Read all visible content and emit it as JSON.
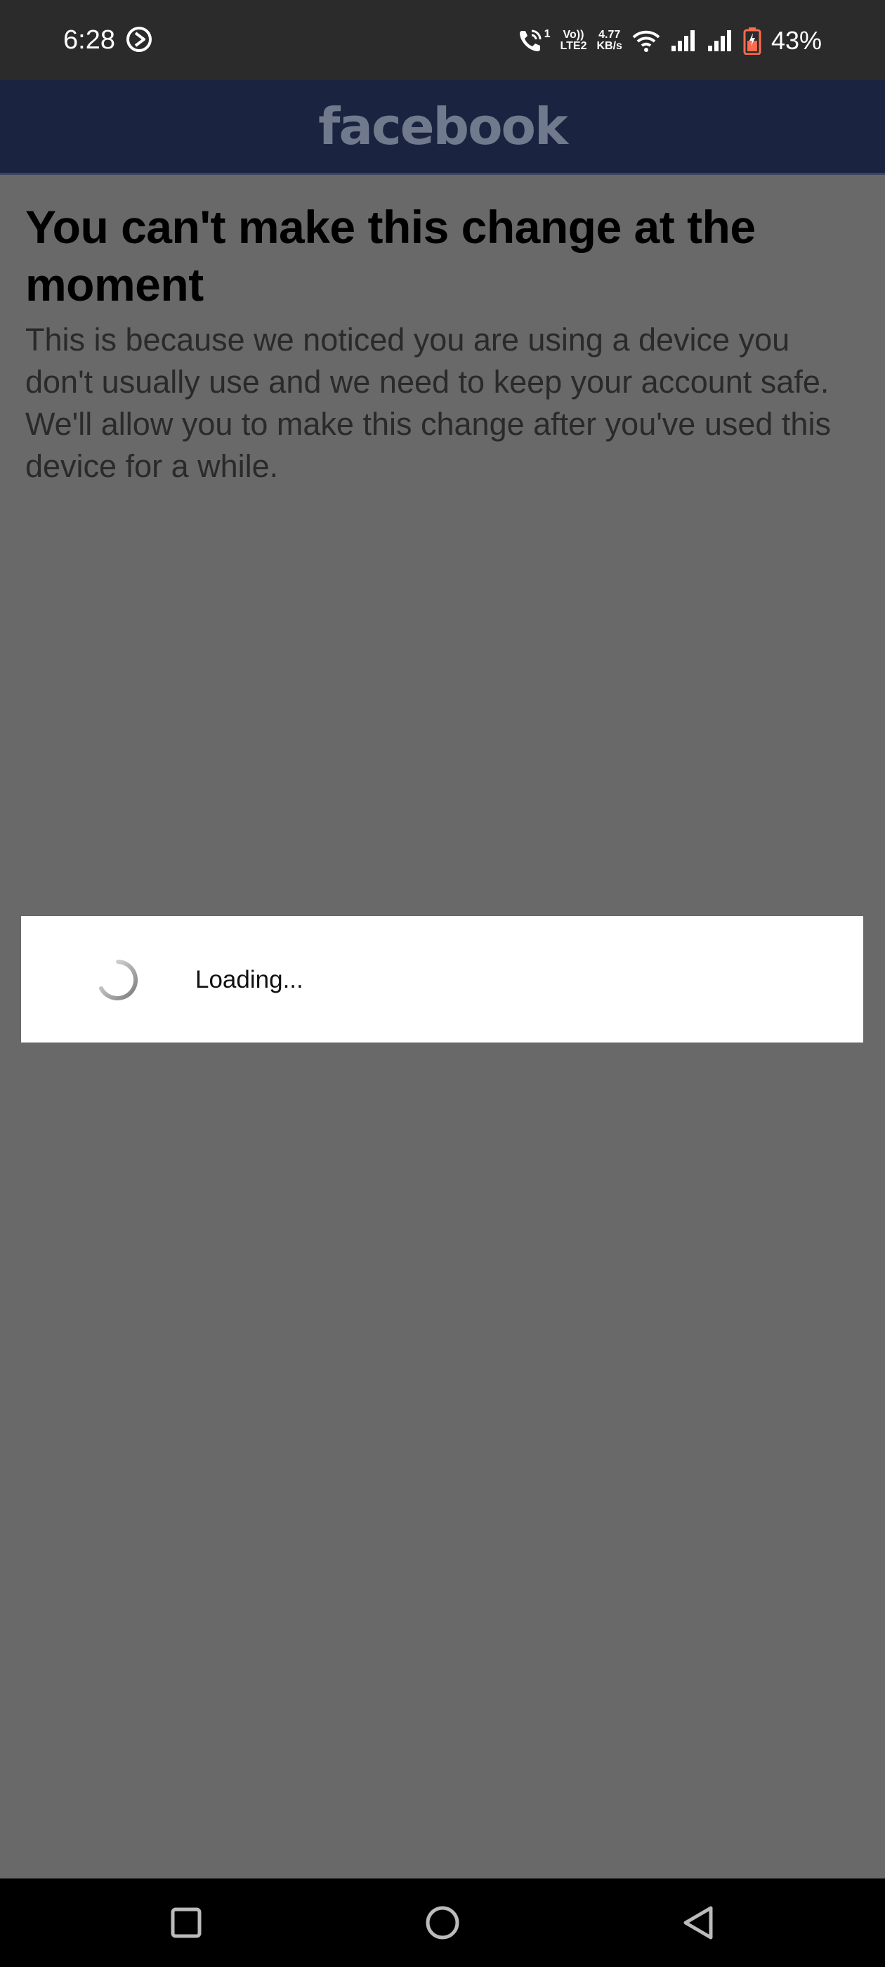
{
  "status_bar": {
    "time": "6:28",
    "call_indicator": "1",
    "volte_top": "Vo))",
    "volte_bottom": "LTE2",
    "network_speed_value": "4.77",
    "network_speed_unit": "KB/s",
    "battery_percent": "43%",
    "icons": [
      "alarm-icon",
      "wifi-call-icon",
      "wifi-icon",
      "signal-icon",
      "signal-icon",
      "battery-icon"
    ]
  },
  "header": {
    "logo_text": "facebook"
  },
  "main": {
    "title": "You can't make this change at the moment",
    "body": "This is because we noticed you are using a device you don't usually use and we need to keep your account safe. We'll allow you to make this change after you've used this device for a while."
  },
  "loading_dialog": {
    "text": "Loading..."
  },
  "nav_bar": {
    "icons": [
      "recent-apps-icon",
      "home-icon",
      "back-icon"
    ]
  },
  "colors": {
    "overlay_background": "#696969",
    "header_background": "#1a2440",
    "status_bar_background": "#2b2b2b",
    "battery_accent": "#ff6a4d"
  }
}
